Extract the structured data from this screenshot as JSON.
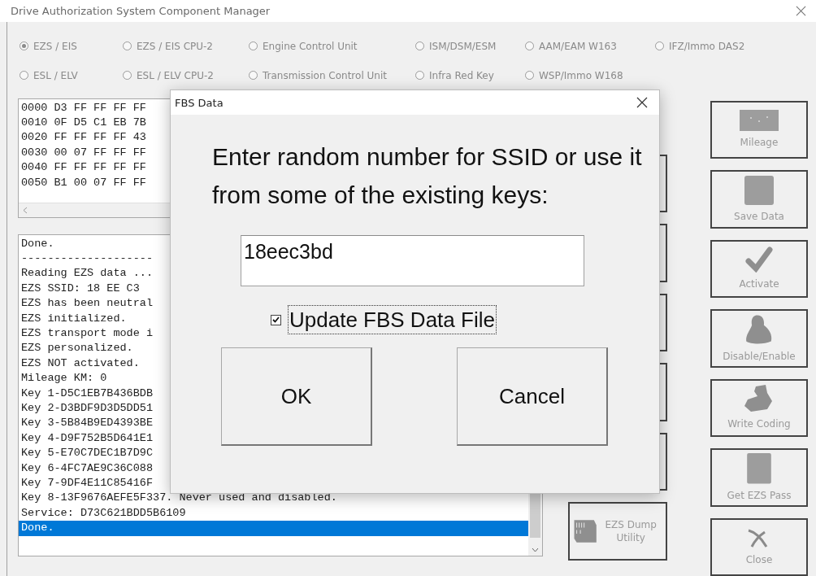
{
  "window": {
    "title": "Drive Authorization System Component Manager"
  },
  "module_rows": [
    {
      "items": [
        {
          "label": "EZS / EIS",
          "selected": true
        },
        {
          "label": "EZS / EIS CPU-2",
          "selected": false
        },
        {
          "label": "Engine Control Unit",
          "selected": false
        },
        {
          "label": "ISM/DSM/ESM",
          "selected": false
        },
        {
          "label": "AAM/EAM W163",
          "selected": false
        },
        {
          "label": "IFZ/Immo DAS2",
          "selected": false
        }
      ]
    },
    {
      "items": [
        {
          "label": "ESL / ELV",
          "selected": false
        },
        {
          "label": "ESL / ELV CPU-2",
          "selected": false
        },
        {
          "label": "Transmission Control Unit",
          "selected": false
        },
        {
          "label": "Infra Red Key",
          "selected": false
        },
        {
          "label": "WSP/Immo W168",
          "selected": false
        }
      ]
    }
  ],
  "hex_dump": {
    "lines": [
      "0000 D3 FF FF FF FF",
      "0010 0F D5 C1 EB 7B",
      "0020 FF FF FF FF 43",
      "0030 00 07 FF FF FF",
      "0040 FF FF FF FF FF",
      "0050 B1 00 07 FF FF"
    ]
  },
  "log": {
    "lines": [
      {
        "text": "Done.",
        "selected": false
      },
      {
        "text": "--------------------",
        "selected": false
      },
      {
        "text": "Reading EZS data ...",
        "selected": false
      },
      {
        "text": "EZS SSID: 18 EE C3",
        "selected": false
      },
      {
        "text": "EZS has been neutral",
        "selected": false
      },
      {
        "text": "EZS initialized.",
        "selected": false
      },
      {
        "text": "EZS transport mode i",
        "selected": false
      },
      {
        "text": "EZS personalized.",
        "selected": false
      },
      {
        "text": "EZS NOT activated.",
        "selected": false
      },
      {
        "text": "Mileage KM: 0",
        "selected": false
      },
      {
        "text": "Key 1-D5C1EB7B436BDB",
        "selected": false
      },
      {
        "text": "Key 2-D3BDF9D3D5DD51",
        "selected": false
      },
      {
        "text": "Key 3-5B84B9ED4393BE",
        "selected": false
      },
      {
        "text": "Key 4-D9F752B5D641E1",
        "selected": false
      },
      {
        "text": "Key 5-E70C7DEC1B7D9C",
        "selected": false
      },
      {
        "text": "Key 6-4FC7AE9C36C088",
        "selected": false
      },
      {
        "text": "Key 7-9DF4E11C85416F",
        "selected": false
      },
      {
        "text": "Key 8-13F9676AEFE5F337. Never used and disabled.",
        "selected": false
      },
      {
        "text": "Service: D73C621BDD5B6109",
        "selected": false
      },
      {
        "text": "Done.",
        "selected": true
      }
    ]
  },
  "middle_buttons": [
    {
      "kind": "covered"
    },
    {
      "kind": "covered"
    },
    {
      "kind": "covered"
    },
    {
      "kind": "covered"
    },
    {
      "kind": "covered"
    },
    {
      "kind": "dump",
      "label": "EZS Dump Utility"
    }
  ],
  "right_buttons": [
    {
      "kind": "mileage",
      "label": "Mileage"
    },
    {
      "kind": "save",
      "label": "Save Data"
    },
    {
      "kind": "activate",
      "label": "Activate"
    },
    {
      "kind": "disable",
      "label": "Disable/Enable"
    },
    {
      "kind": "coding",
      "label": "Write Coding"
    },
    {
      "kind": "pass",
      "label": "Get EZS Pass"
    },
    {
      "kind": "close",
      "label": "Close"
    }
  ],
  "dialog": {
    "title": "FBS Data",
    "prompt": "Enter random number for SSID or use it from some of the existing keys:",
    "input": {
      "value": "18eec3bd"
    },
    "checkbox": {
      "label": "Update FBS Data File",
      "checked": true
    },
    "buttons": [
      "OK",
      "Cancel"
    ]
  }
}
